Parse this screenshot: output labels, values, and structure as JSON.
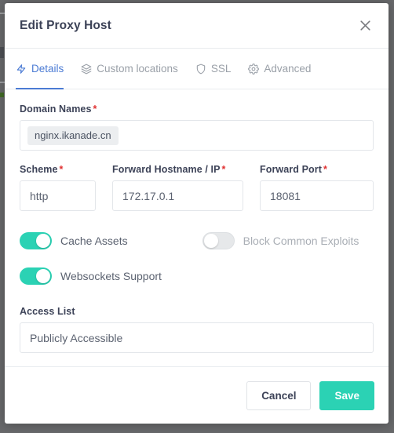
{
  "header": {
    "title": "Edit Proxy Host",
    "close_icon": "close-icon"
  },
  "tabs": [
    {
      "label": "Details",
      "icon": "bolt-icon",
      "active": true
    },
    {
      "label": "Custom locations",
      "icon": "layers-icon",
      "active": false
    },
    {
      "label": "SSL",
      "icon": "shield-icon",
      "active": false
    },
    {
      "label": "Advanced",
      "icon": "gear-icon",
      "active": false
    }
  ],
  "form": {
    "domain_names": {
      "label": "Domain Names",
      "required_marker": "*",
      "tags": [
        "nginx.ikanade.cn"
      ]
    },
    "scheme": {
      "label": "Scheme",
      "required_marker": "*",
      "value": "http"
    },
    "forward_hostname": {
      "label": "Forward Hostname / IP",
      "required_marker": "*",
      "value": "172.17.0.1"
    },
    "forward_port": {
      "label": "Forward Port",
      "required_marker": "*",
      "value": "18081"
    },
    "toggles": {
      "cache_assets": {
        "label": "Cache Assets",
        "state": "on"
      },
      "block_common_exploits": {
        "label": "Block Common Exploits",
        "state": "off"
      },
      "websockets_support": {
        "label": "Websockets Support",
        "state": "on"
      }
    },
    "access_list": {
      "label": "Access List",
      "value": "Publicly Accessible"
    }
  },
  "footer": {
    "cancel_label": "Cancel",
    "save_label": "Save"
  },
  "colors": {
    "accent_teal": "#2bd2b4",
    "tab_active_blue": "#4b7bd4",
    "required_red": "#e03131",
    "text_dark": "#3c4257",
    "text_muted": "#9aa0a8",
    "backdrop": "#68696b"
  }
}
